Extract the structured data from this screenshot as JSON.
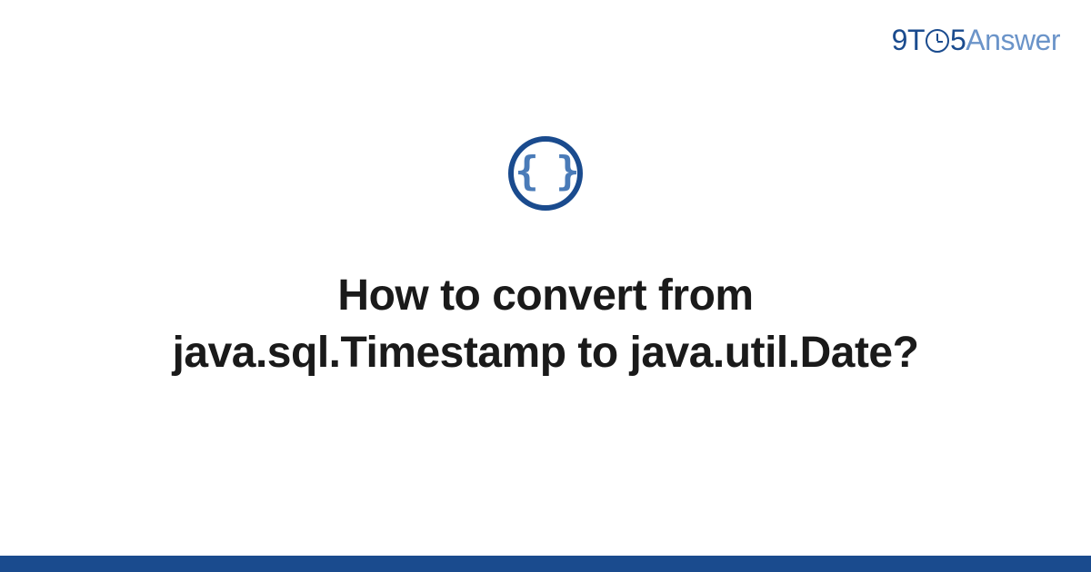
{
  "logo": {
    "prefix": "9T",
    "middle": "5",
    "suffix": "Answer"
  },
  "icon": {
    "name": "braces-icon",
    "glyph": "{ }"
  },
  "title": "How to convert from java.sql.Timestamp to java.util.Date?",
  "colors": {
    "primary": "#1a4b8e",
    "secondary": "#6b94c9",
    "text": "#1a1a1a"
  }
}
